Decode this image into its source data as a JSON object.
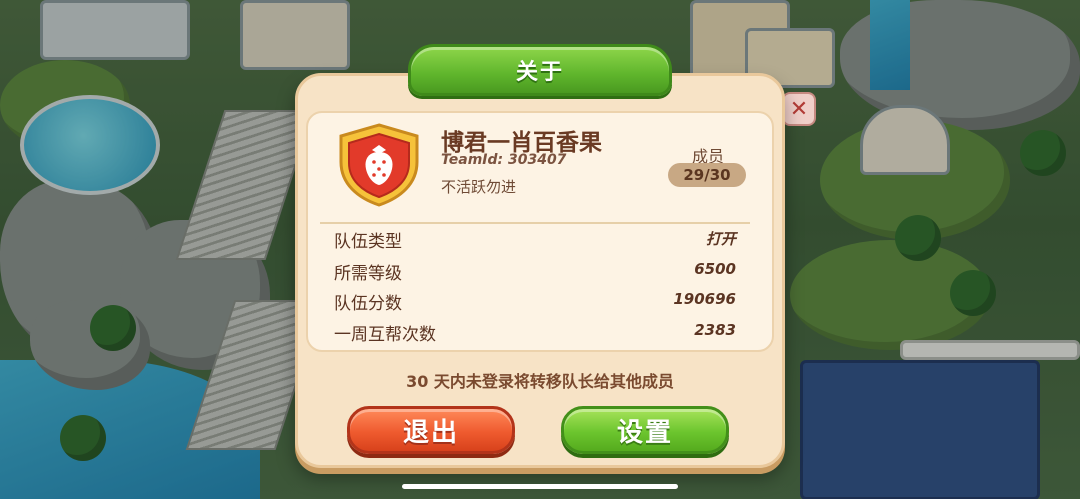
{
  "dialog": {
    "title": "关于",
    "close_icon": "close-icon",
    "team": {
      "name": "博君一肖百香果",
      "team_id": "TeamId: 303407",
      "motto": "不活跃勿进",
      "emblem_icon": "strawberry-shield-icon"
    },
    "members": {
      "label": "成员",
      "count": "29/30"
    },
    "stats": [
      {
        "label": "队伍类型",
        "value": "打开"
      },
      {
        "label": "所需等级",
        "value": "6500"
      },
      {
        "label": "队伍分数",
        "value": "190696"
      },
      {
        "label": "一周互帮次数",
        "value": "2383"
      }
    ],
    "notice": "30 天内未登录将转移队长给其他成员",
    "buttons": {
      "exit": "退出",
      "settings": "设置"
    }
  },
  "colors": {
    "title_green": "#5fb52c",
    "exit_red": "#ef5b2f",
    "settings_green": "#6cc52e",
    "panel_cream": "#f7e3c6",
    "text_brown": "#5b3422"
  }
}
